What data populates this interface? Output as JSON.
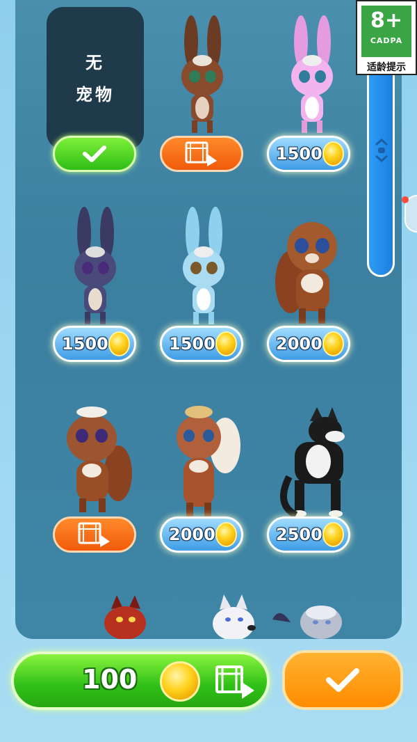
{
  "no_pet": {
    "line1": "无",
    "line2": "宠物"
  },
  "items": [
    {
      "name": "brown-bunny",
      "action": "video"
    },
    {
      "name": "pink-bunny",
      "price": "1500"
    },
    {
      "name": "navy-bunny",
      "price": "1500"
    },
    {
      "name": "blue-bunny",
      "price": "1500"
    },
    {
      "name": "brown-squirrel",
      "price": "2000"
    },
    {
      "name": "squirrel-girl",
      "action": "video"
    },
    {
      "name": "blonde-squirrel",
      "price": "2000"
    },
    {
      "name": "black-wolf",
      "price": "2500"
    }
  ],
  "age_badge": {
    "rating": "8+",
    "org": "CADPA",
    "label": "适龄提示"
  },
  "coins": {
    "count": "100"
  },
  "colors": {
    "panel": "#3f84a5",
    "green": "#2fbd16",
    "orange": "#f05a0a",
    "price_blue": "#3f9ce6",
    "confirm": "#ff9a10"
  }
}
